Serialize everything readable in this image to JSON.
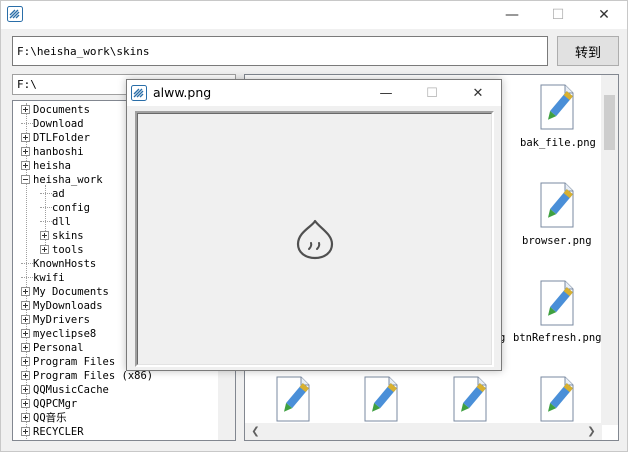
{
  "window": {
    "title_icon": "app-logo-icon",
    "min_glyph": "—",
    "max_glyph": "☐",
    "close_glyph": "✕"
  },
  "toolbar": {
    "path_value": "F:\\heisha_work\\skins",
    "go_label": "转到"
  },
  "drive": {
    "value": "F:\\"
  },
  "tree": {
    "items": [
      {
        "label": "Documents",
        "expander": "plus"
      },
      {
        "label": "Download",
        "expander": "none"
      },
      {
        "label": "DTLFolder",
        "expander": "plus"
      },
      {
        "label": "hanboshi",
        "expander": "plus"
      },
      {
        "label": "heisha",
        "expander": "plus"
      },
      {
        "label": "heisha_work",
        "expander": "minus"
      },
      {
        "label": "ad",
        "expander": "none"
      },
      {
        "label": "config",
        "expander": "none"
      },
      {
        "label": "dll",
        "expander": "none"
      },
      {
        "label": "skins",
        "expander": "plus"
      },
      {
        "label": "tools",
        "expander": "plus"
      },
      {
        "label": "KnownHosts",
        "expander": "none"
      },
      {
        "label": "kwifi",
        "expander": "none"
      },
      {
        "label": "My Documents",
        "expander": "plus"
      },
      {
        "label": "MyDownloads",
        "expander": "plus"
      },
      {
        "label": "MyDrivers",
        "expander": "plus"
      },
      {
        "label": "myeclipse8",
        "expander": "plus"
      },
      {
        "label": "Personal",
        "expander": "plus"
      },
      {
        "label": "Program Files",
        "expander": "plus"
      },
      {
        "label": "Program Files (x86)",
        "expander": "plus"
      },
      {
        "label": "QQMusicCache",
        "expander": "plus"
      },
      {
        "label": "QQPCMgr",
        "expander": "plus"
      },
      {
        "label": "QQ音乐",
        "expander": "plus"
      },
      {
        "label": "RECYCLER",
        "expander": "plus"
      }
    ]
  },
  "files": {
    "items": [
      {
        "name": "bak_file.png"
      },
      {
        "name": "browser.png"
      },
      {
        "name": "btnRefresh.png"
      }
    ],
    "partial_label_char": "g"
  },
  "dialog": {
    "title": "alww.png",
    "min_glyph": "—",
    "max_glyph": "☐",
    "close_glyph": "✕",
    "icon": "image-file-icon",
    "status_icon": "loading-face-icon"
  },
  "colors": {
    "accent": "#2a6ea8",
    "pencil_body": "#4a8fd8",
    "pencil_tip": "#d8b030",
    "pencil_end": "#3fa040"
  }
}
